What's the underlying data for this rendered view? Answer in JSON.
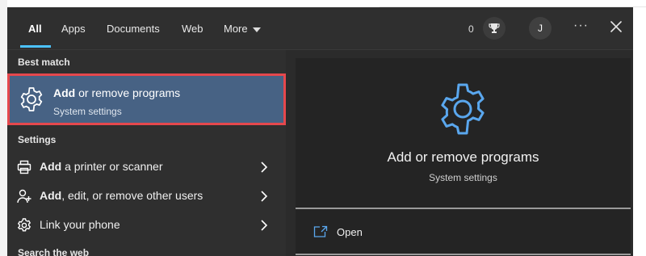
{
  "tabs": [
    {
      "label": "All",
      "active": true
    },
    {
      "label": "Apps"
    },
    {
      "label": "Documents"
    },
    {
      "label": "Web"
    },
    {
      "label": "More"
    }
  ],
  "header": {
    "points": "0",
    "avatar_initial": "J",
    "options_glyph": "···",
    "trophy_icon": "trophy-icon",
    "close_icon": "close-icon"
  },
  "left": {
    "best_match_header": "Best match",
    "best_match": {
      "title_bold": "Add",
      "title_rest": " or remove programs",
      "subtitle": "System settings",
      "icon": "gear-icon"
    },
    "settings_header": "Settings",
    "settings_items": [
      {
        "bold": "Add",
        "rest": " a printer or scanner",
        "icon": "printer-icon"
      },
      {
        "bold": "Add",
        "rest": ", edit, or remove other users",
        "icon": "user-icon"
      },
      {
        "bold": "",
        "rest": "Link your phone",
        "icon": "gear-icon"
      }
    ],
    "web_header": "Search the web"
  },
  "preview": {
    "title": "Add or remove programs",
    "subtitle": "System settings",
    "action_open": "Open",
    "icon": "gear-icon",
    "action_icon": "open-window-icon"
  },
  "colors": {
    "accent": "#4cc2ff",
    "highlight": "#476284",
    "selection_border": "#e5484d",
    "panel_bg": "#2b2b2b"
  }
}
